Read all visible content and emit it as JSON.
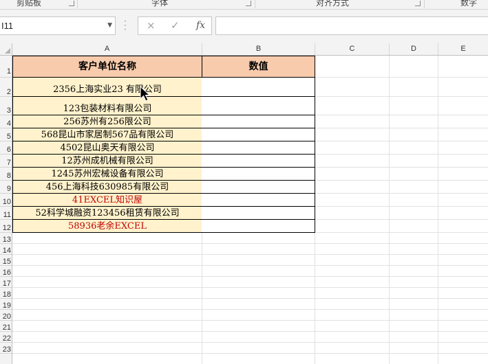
{
  "ribbon": {
    "groups": [
      {
        "label": "剪贴板"
      },
      {
        "label": "字体"
      },
      {
        "label": "对齐方式"
      },
      {
        "label": "数字"
      }
    ]
  },
  "formula_bar": {
    "name_box": "I11",
    "cancel_icon": "×",
    "enter_icon": "✓",
    "fx_label": "fx",
    "formula": ""
  },
  "columns": [
    "A",
    "B",
    "C",
    "D",
    "E"
  ],
  "rows": [
    "1",
    "2",
    "3",
    "4",
    "5",
    "6",
    "7",
    "8",
    "9",
    "10",
    "11",
    "12",
    "13",
    "14",
    "15",
    "16",
    "17",
    "18",
    "19",
    "20",
    "21",
    "22",
    "23"
  ],
  "table": {
    "header": {
      "col_a": "客户单位名称",
      "col_b": "数值"
    },
    "rows": [
      {
        "name": "2356上海实业23  有限公司",
        "value": "",
        "color": "#000000"
      },
      {
        "name": "123包装材料有限公司",
        "value": "",
        "color": "#000000"
      },
      {
        "name": "256苏州有256限公司",
        "value": "",
        "color": "#000000"
      },
      {
        "name": "568昆山市家居制567品有限公司",
        "value": "",
        "color": "#000000"
      },
      {
        "name": "4502昆山奥天有限公司",
        "value": "",
        "color": "#000000"
      },
      {
        "name": "12苏州成机械有限公司",
        "value": "",
        "color": "#000000"
      },
      {
        "name": "1245苏州宏械设备有限公司",
        "value": "",
        "color": "#000000"
      },
      {
        "name": "456上海科技630985有限公司",
        "value": "",
        "color": "#000000"
      },
      {
        "name": "41EXCEL知识屋",
        "value": "",
        "color": "#c00000"
      },
      {
        "name": "52科学城融资123456租赁有限公司",
        "value": "",
        "color": "#000000"
      },
      {
        "name": "58936老余EXCEL",
        "value": "",
        "color": "#c00000"
      }
    ]
  },
  "colors": {
    "header_fill": "#f8cbad",
    "name_fill": "#fff2cc",
    "accent_red": "#c00000"
  }
}
